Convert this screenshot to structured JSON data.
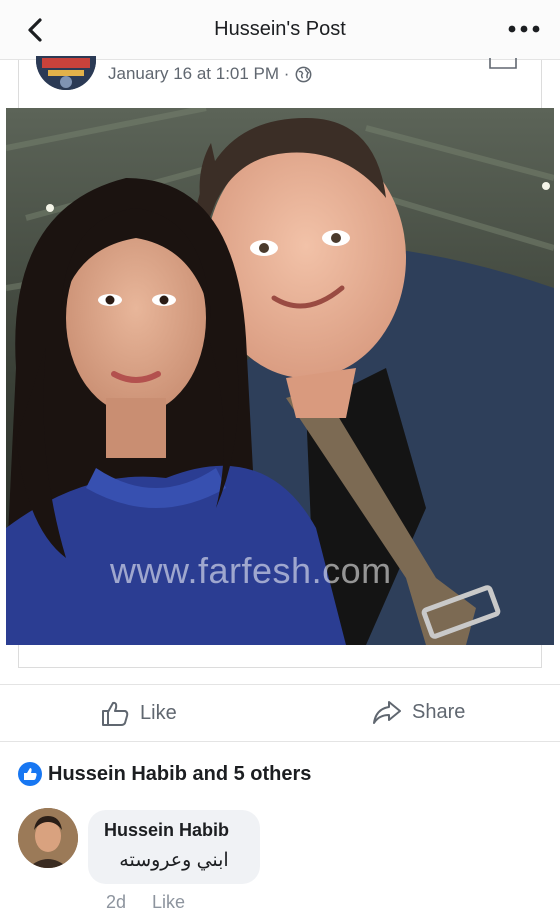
{
  "topbar": {
    "title": "Hussein's Post"
  },
  "post": {
    "timestamp": "January 16 at 1:01 PM · ",
    "watermark": "www.farfesh.com"
  },
  "actions": {
    "like_label": "Like",
    "share_label": "Share"
  },
  "reactions": {
    "summary": "Hussein Habib and 5 others"
  },
  "comment": {
    "author": "Hussein Habib",
    "text": "ابني وعروسته",
    "age": "2d",
    "like_label": "Like"
  },
  "colors": {
    "accent": "#1877f2",
    "muted": "#606770",
    "bubble": "#f0f2f5"
  },
  "icons": [
    "back-arrow-icon",
    "more-icon",
    "globe-icon",
    "bookmark-icon",
    "person-icon",
    "like-icon",
    "share-icon",
    "like-badge-icon"
  ]
}
